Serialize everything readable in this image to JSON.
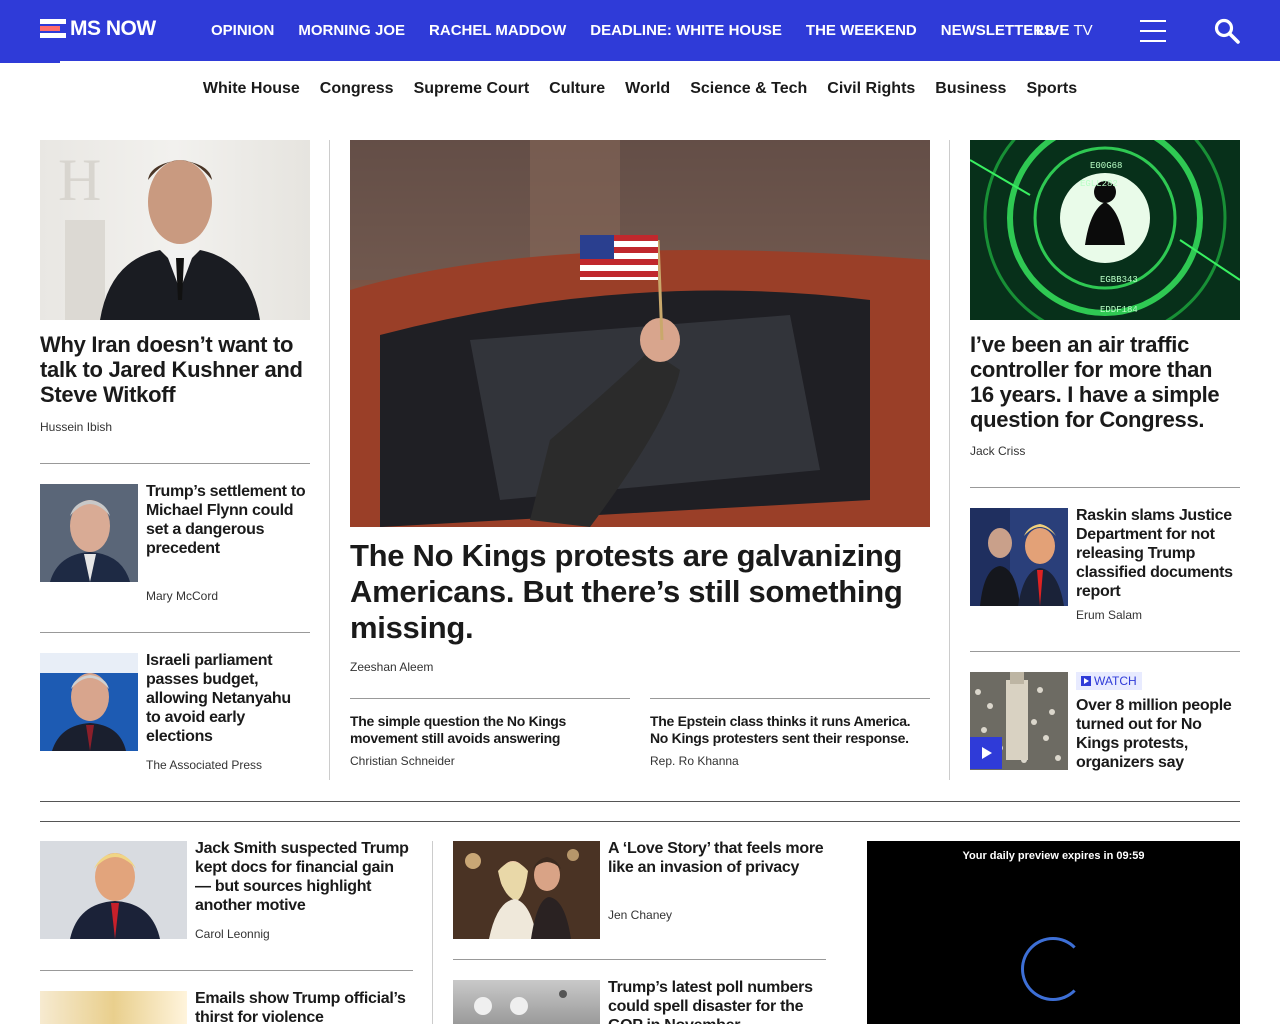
{
  "brand": {
    "logo_text": "MS NOW",
    "accent_color": "#2f3bd8"
  },
  "topnav": {
    "items": [
      "OPINION",
      "MORNING JOE",
      "RACHEL MADDOW",
      "DEADLINE: WHITE HOUSE",
      "THE WEEKEND",
      "NEWSLETTERS"
    ],
    "live_tv": {
      "strong": "LIVE",
      "light": "TV"
    }
  },
  "subnav": {
    "items": [
      "White House",
      "Congress",
      "Supreme Court",
      "Culture",
      "World",
      "Science & Tech",
      "Civil Rights",
      "Business",
      "Sports"
    ]
  },
  "left_column": {
    "lead": {
      "headline": "Why Iran doesn’t want to talk to Jared Kushner and Steve Witkoff",
      "byline": "Hussein Ibish",
      "image_icon": "portrait-photo"
    },
    "stories": [
      {
        "headline": "Trump’s settlement to Michael Flynn could set a dangerous precedent",
        "byline": "Mary McCord"
      },
      {
        "headline": "Israeli parliament passes budget, allowing Netanyahu to avoid early elections",
        "byline": "The Associated Press"
      }
    ]
  },
  "center_column": {
    "lead": {
      "headline": "The No Kings protests are galvanizing Americans. But there’s still something missing.",
      "byline": "Zeeshan Aleem"
    },
    "related": [
      {
        "headline": "The simple question the No Kings movement still avoids answering",
        "byline": "Christian Schneider"
      },
      {
        "headline": "The Epstein class thinks it runs America. No Kings protesters sent their response.",
        "byline": "Rep. Ro Khanna"
      }
    ]
  },
  "right_column": {
    "lead": {
      "headline": "I’ve been an air traffic controller for more than 16 years. I have a simple question for Congress.",
      "byline": "Jack Criss"
    },
    "stories": [
      {
        "headline": "Raskin slams Justice Department for not releasing Trump classified documents report",
        "byline": "Erum Salam"
      },
      {
        "headline": "Over 8 million people turned out for No Kings protests, organizers say",
        "badge": "WATCH"
      }
    ]
  },
  "lower_section": {
    "col1": [
      {
        "headline": "Jack Smith suspected Trump kept docs for financial gain — but sources highlight another motive",
        "byline": "Carol Leonnig"
      },
      {
        "headline": "Emails show Trump official’s thirst for violence"
      }
    ],
    "col2": [
      {
        "headline": "A ‘Love Story’ that feels more like an invasion of privacy",
        "byline": "Jen Chaney"
      },
      {
        "headline": "Trump’s latest poll numbers could spell disaster for the GOP in November"
      }
    ],
    "video": {
      "label": "Your daily preview expires in 09:59"
    }
  }
}
